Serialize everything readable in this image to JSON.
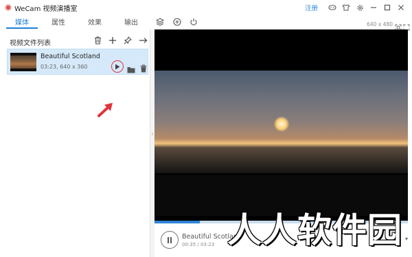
{
  "window": {
    "app_title": "WeCam 视频演播室",
    "register_label": "注册",
    "icons": [
      "gamepad-icon",
      "shirt-icon",
      "gear-icon",
      "minimize-icon",
      "maximize-icon",
      "close-icon"
    ]
  },
  "tabs": [
    {
      "label": "媒体",
      "active": true
    },
    {
      "label": "属性",
      "active": false
    },
    {
      "label": "效果",
      "active": false
    },
    {
      "label": "输出",
      "active": false
    }
  ],
  "toolbar_icons": [
    "layers-icon",
    "add-circle-icon",
    "power-icon"
  ],
  "resolution_label": "640 x 480",
  "media_panel": {
    "title": "视频文件列表",
    "tools": [
      "trash-icon",
      "plus-icon",
      "pin-icon",
      "arrow-right-icon"
    ],
    "files": [
      {
        "name": "Beautiful Scotland",
        "meta": "03:23, 640 x 360"
      }
    ]
  },
  "player": {
    "title": "Beautiful Scotlan",
    "time": "00:35 / 03:23",
    "progress": 0.18
  },
  "watermark_text": "人人软件园",
  "colors": {
    "accent": "#1f7ed6",
    "annotation": "#e0353b",
    "selection": "#d6e9fa"
  }
}
